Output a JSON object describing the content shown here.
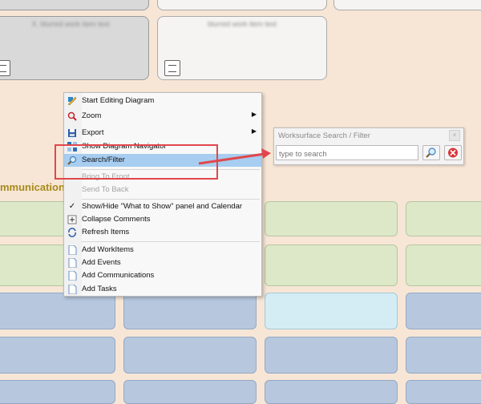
{
  "section": {
    "title": "mmunications"
  },
  "context_menu": {
    "items": [
      {
        "label": "Start Editing Diagram",
        "icon": "pencil-icon",
        "disabled": false
      },
      {
        "label": "Zoom",
        "icon": "zoom-icon",
        "submenu": true
      },
      {
        "label": "Export",
        "icon": "save-icon",
        "submenu": true
      },
      {
        "label": "Show Diagram Navigator",
        "icon": "navigator-icon"
      },
      {
        "label": "Search/Filter",
        "icon": "search-icon",
        "highlighted": true
      },
      {
        "label": "Bring To Front",
        "icon": "",
        "disabled": true
      },
      {
        "label": "Send To Back",
        "icon": "",
        "disabled": true
      },
      {
        "label": "Show/Hide \"What to Show\" panel and Calendar",
        "icon": "check-icon"
      },
      {
        "label": "Collapse Comments",
        "icon": "collapse-icon"
      },
      {
        "label": "Refresh Items",
        "icon": "refresh-icon"
      },
      {
        "label": "Add WorkItems",
        "icon": "document-icon"
      },
      {
        "label": "Add Events",
        "icon": "document-icon"
      },
      {
        "label": "Add Communications",
        "icon": "document-icon"
      },
      {
        "label": "Add Tasks",
        "icon": "document-icon"
      }
    ]
  },
  "search_panel": {
    "title": "Worksurface Search / Filter",
    "placeholder": "type to search",
    "value": ""
  },
  "colors": {
    "background": "#f7e6d6",
    "highlight": "#a7cdf0",
    "annotation": "#e0474c"
  }
}
